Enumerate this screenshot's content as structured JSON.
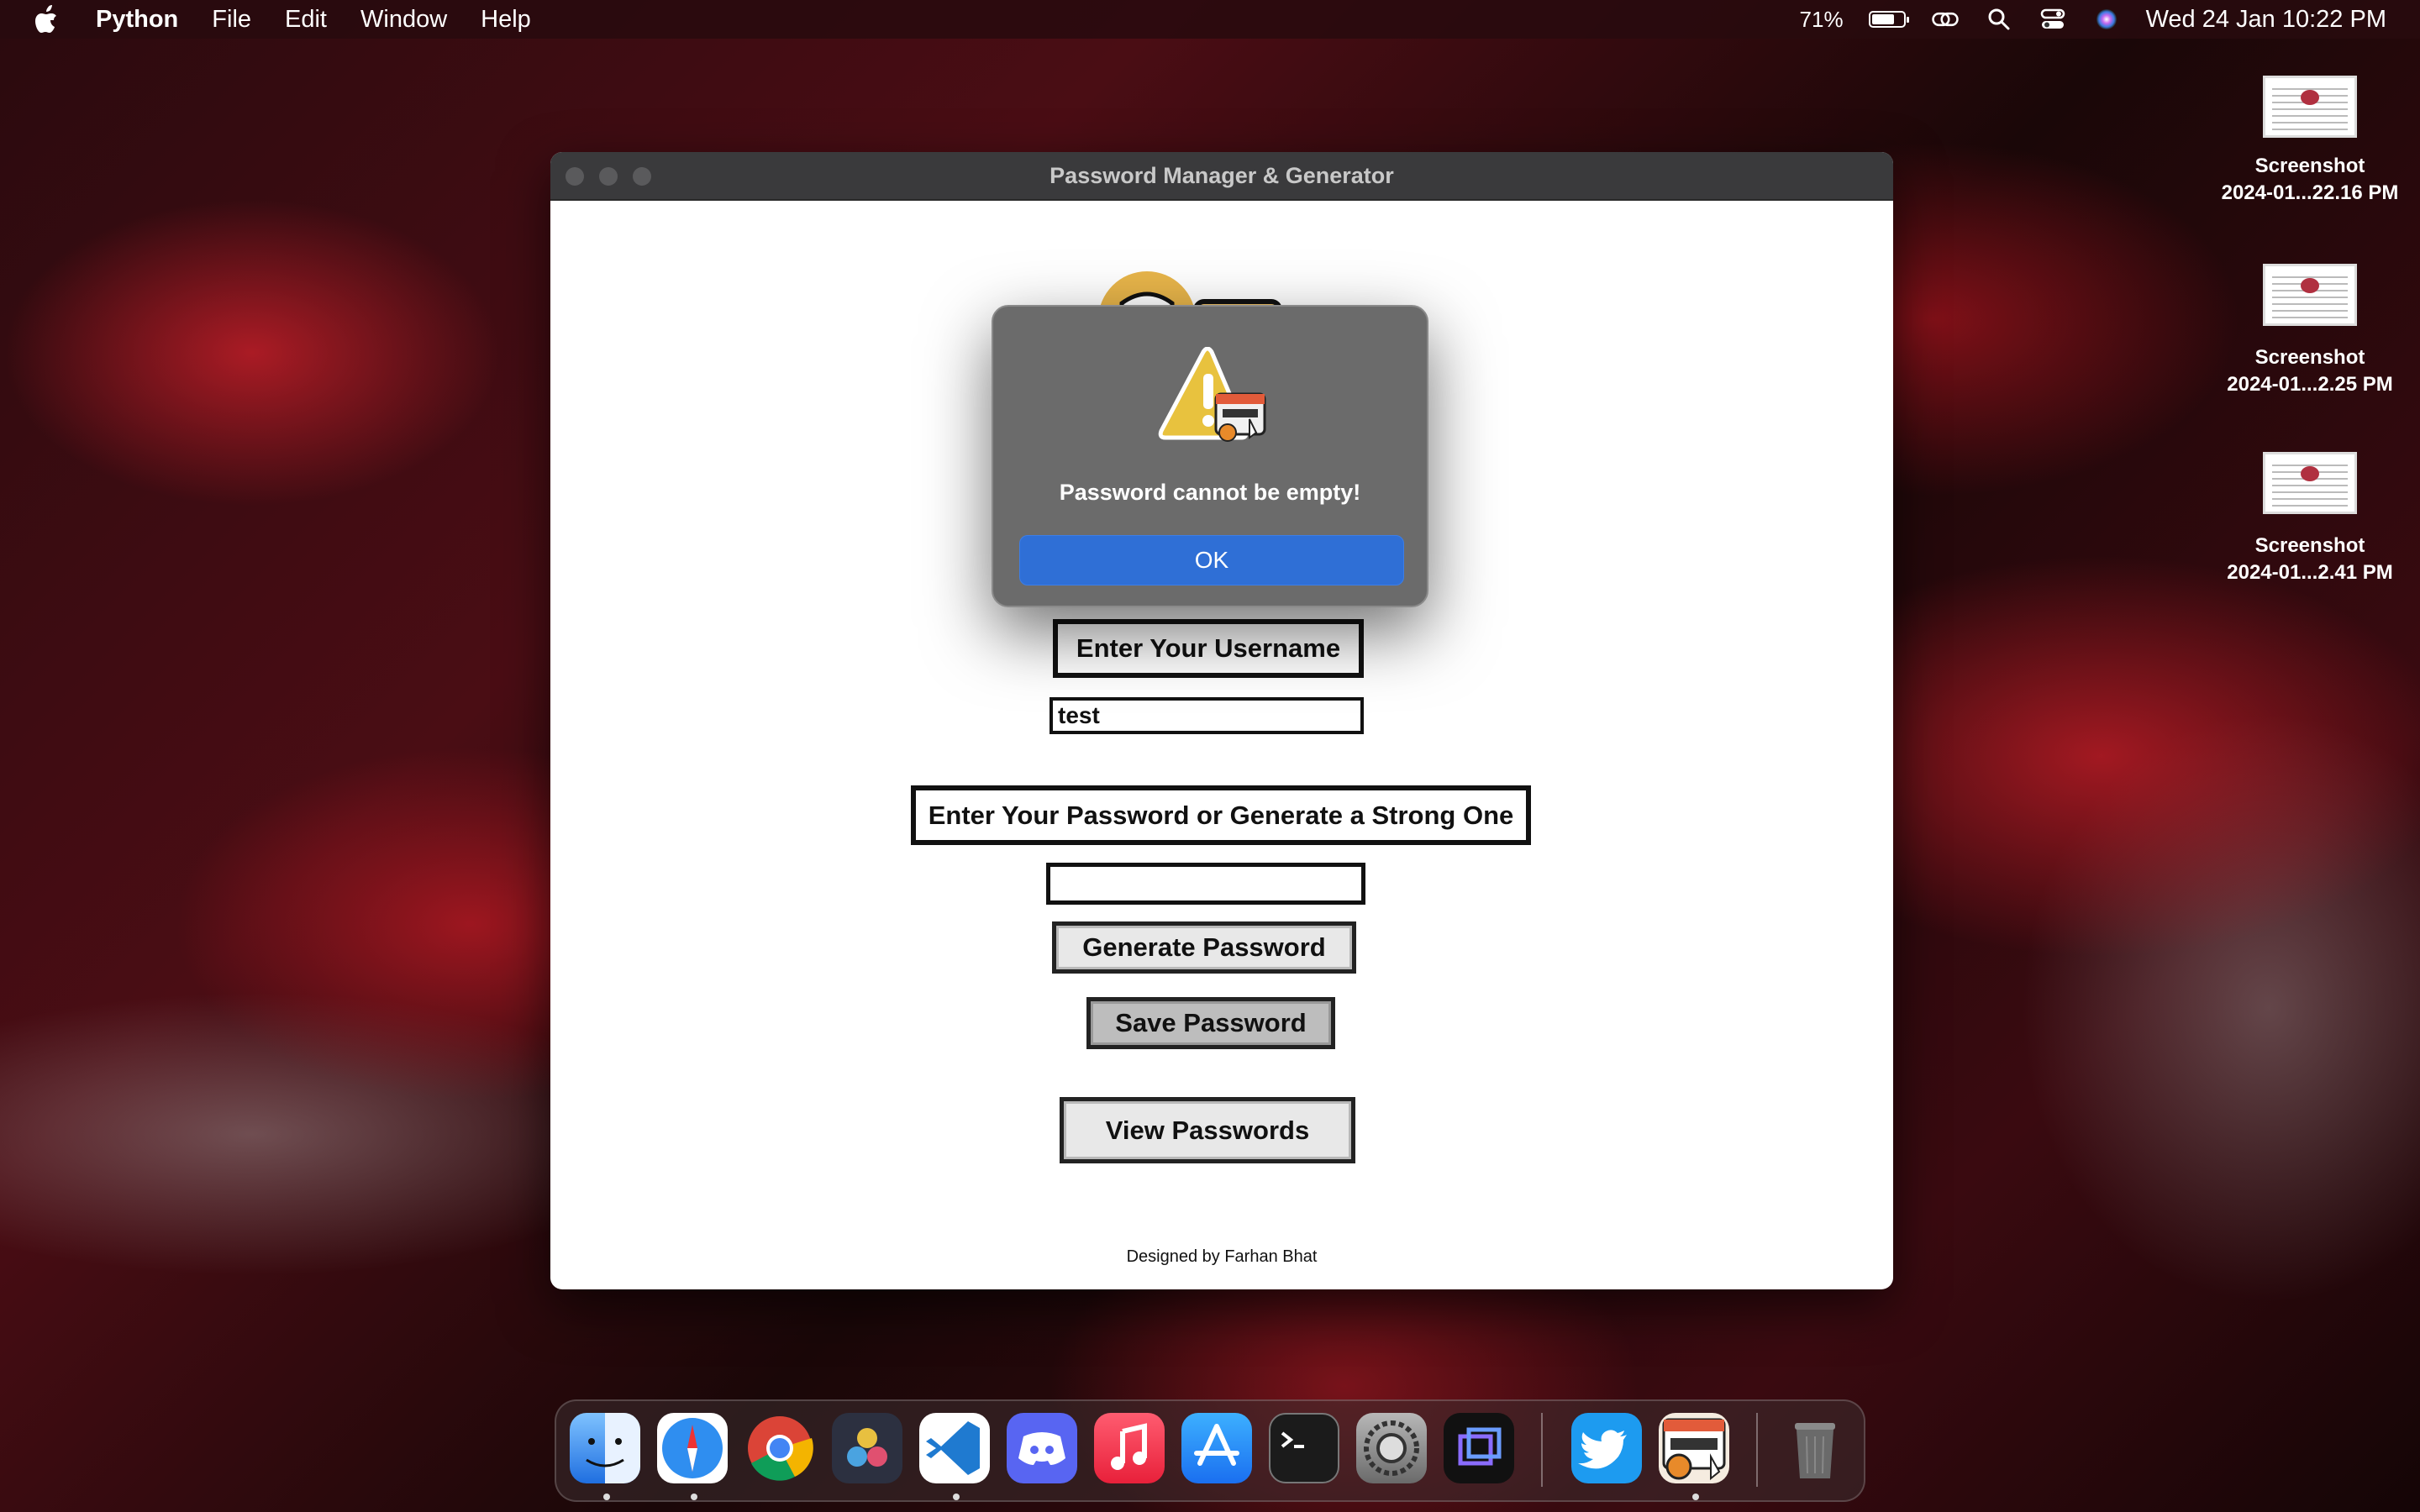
{
  "menubar": {
    "app_name": "Python",
    "items": [
      "File",
      "Edit",
      "Window",
      "Help"
    ],
    "battery_percent": "71%",
    "battery_level": 0.71,
    "datetime": "Wed 24 Jan  10:22 PM"
  },
  "desktop_files": [
    {
      "line1": "Screenshot",
      "line2": "2024-01...22.16 PM"
    },
    {
      "line1": "Screenshot",
      "line2": "2024-01...2.25 PM"
    },
    {
      "line1": "Screenshot",
      "line2": "2024-01...2.41 PM"
    }
  ],
  "window": {
    "title": "Password Manager & Generator",
    "username_label": "Enter Your Username",
    "username_value": "test",
    "password_label": "Enter Your Password or Generate a Strong One",
    "password_value": "",
    "generate_button": "Generate Password",
    "save_button": "Save Password",
    "view_button": "View Passwords",
    "footer": "Designed by Farhan Bhat"
  },
  "alert": {
    "message": "Password cannot be empty!",
    "ok_label": "OK"
  },
  "dock": {
    "apps": [
      "finder-icon",
      "safari-icon",
      "chrome-icon",
      "davinci-resolve-icon",
      "vscode-icon",
      "discord-icon",
      "music-icon",
      "app-store-icon",
      "terminal-icon",
      "system-settings-icon",
      "screen-recorder-icon",
      "twitter-icon",
      "password-manager-icon",
      "trash-icon"
    ]
  },
  "colors": {
    "accent_blue": "#2f6fd6",
    "alert_bg": "#6b6b6b",
    "titlebar": "#3a3a3c"
  }
}
